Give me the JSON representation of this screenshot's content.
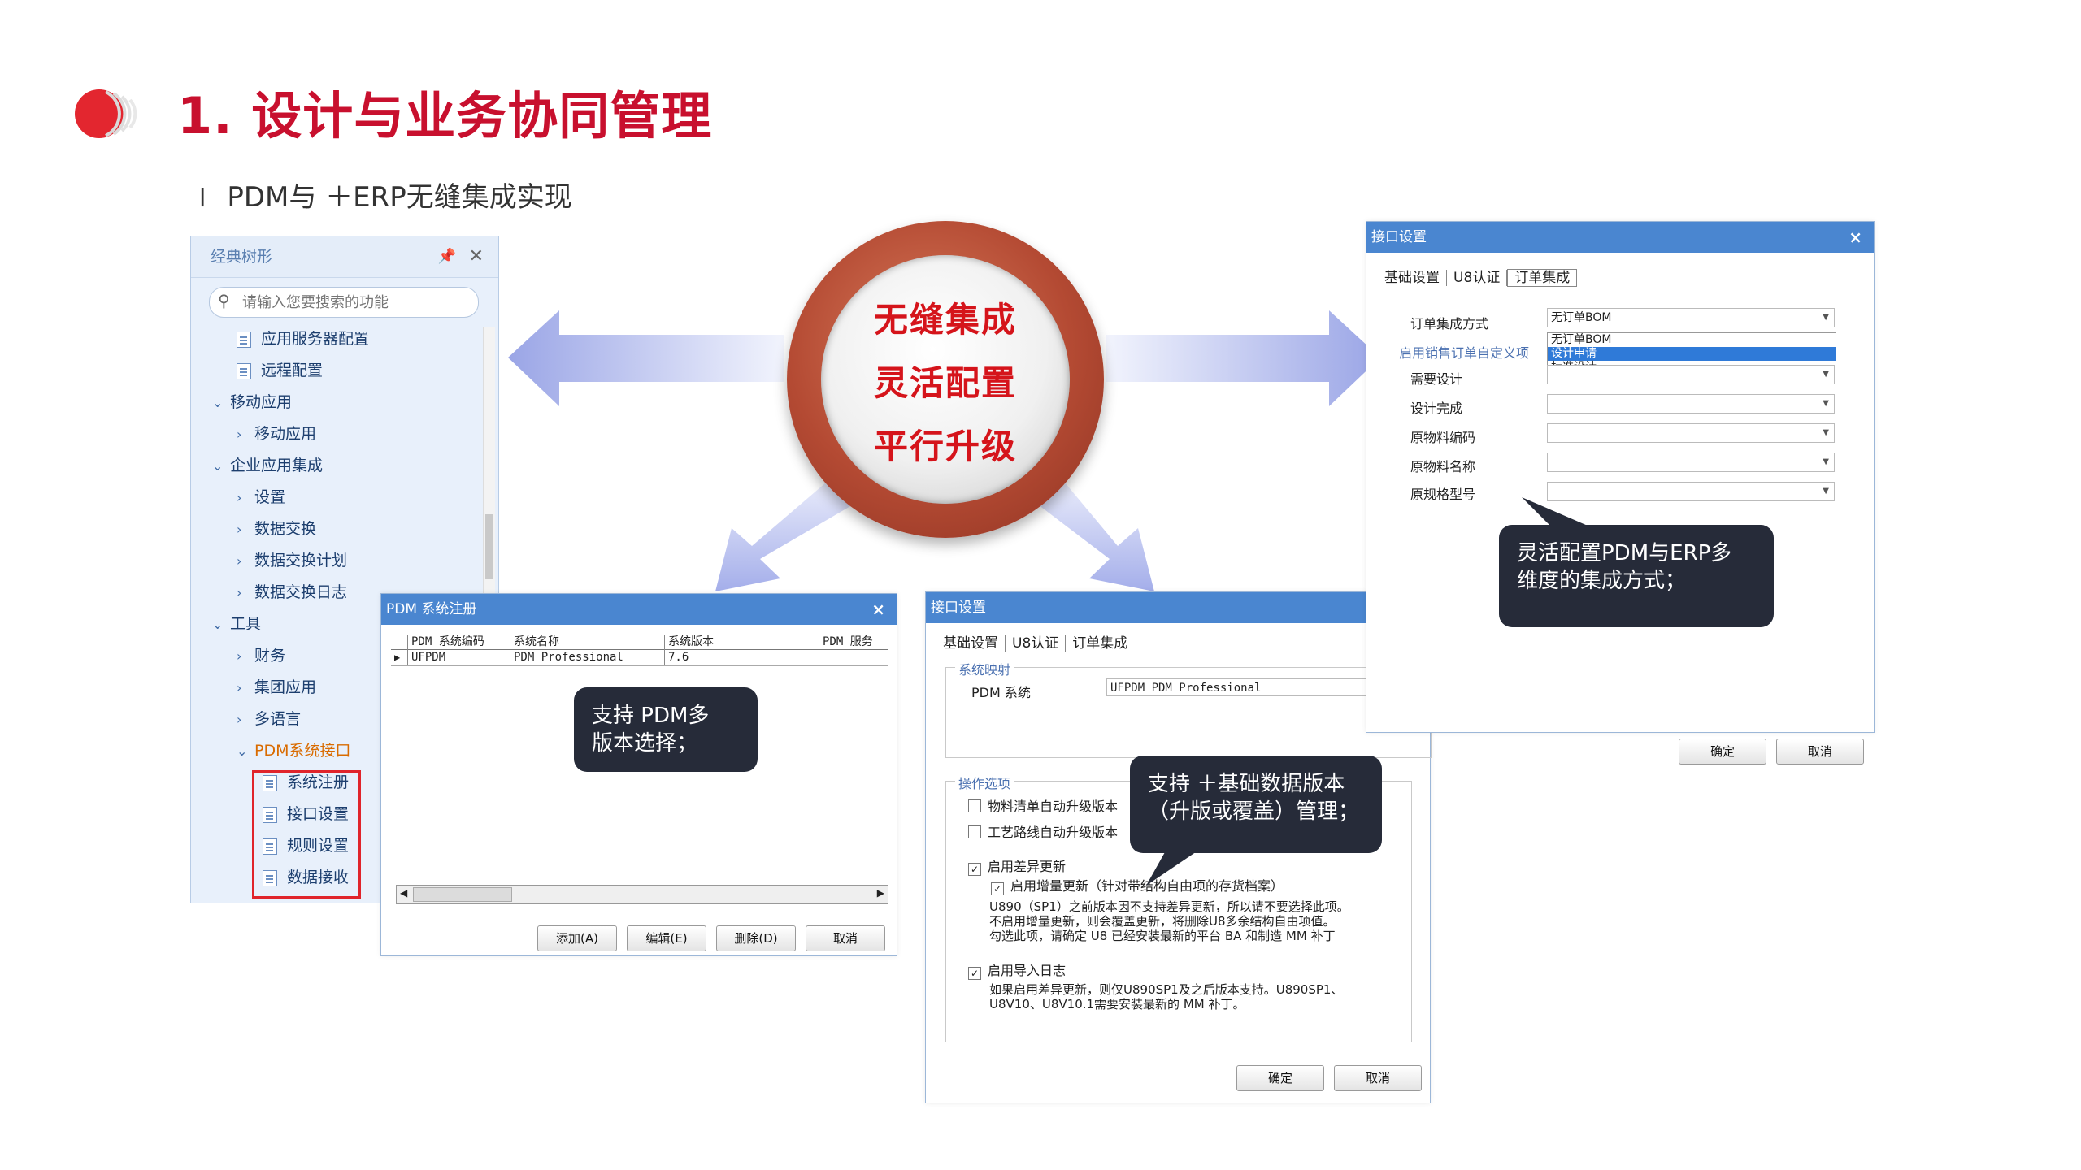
{
  "header": {
    "title": "1. 设计与业务协同管理",
    "subtitle_bullet": "l",
    "subtitle": "PDM与 ＋ERP无缝集成实现"
  },
  "badge": {
    "line1": "无缝集成",
    "line2": "灵活配置",
    "line3": "平行升级"
  },
  "tree": {
    "title": "经典树形",
    "search_placeholder": "请输入您要搜索的功能",
    "items": [
      "应用服务器配置",
      "远程配置",
      "移动应用",
      "移动应用",
      "企业应用集成",
      "设置",
      "数据交换",
      "数据交换计划",
      "数据交换日志",
      "工具",
      "财务",
      "集团应用",
      "多语言",
      "PDM系统接口",
      "系统注册",
      "接口设置",
      "规则设置",
      "数据接收"
    ]
  },
  "pdm_window": {
    "title": "PDM 系统注册",
    "columns": [
      "PDM 系统编码",
      "系统名称",
      "系统版本",
      "PDM 服务"
    ],
    "row": [
      "UFPDM",
      "PDM Professional",
      "7.6",
      ""
    ],
    "buttons": {
      "add": "添加(A)",
      "edit": "编辑(E)",
      "delete": "删除(D)",
      "cancel": "取消"
    }
  },
  "iface_bottom": {
    "title": "接口设置",
    "tabs": [
      "基础设置",
      "U8认证",
      "订单集成"
    ],
    "group_mapping": "系统映射",
    "pdm_label": "PDM 系统",
    "pdm_value": "UFPDM PDM Professional",
    "group_ops": "操作选项",
    "opt1": "物料清单自动升级版本",
    "opt2": "工艺路线自动升级版本",
    "opt3": "启用差异更新",
    "opt4": "启用增量更新（针对带结构自由项的存货档案）",
    "note1": "U890（SP1）之前版本因不支持差异更新，所以请不要选择此项。",
    "note2": "不启用增量更新，则会覆盖更新，将删除U8多余结构自由项值。",
    "note3": "勾选此项，请确定 U8 已经安装最新的平台 BA 和制造 MM 补丁",
    "opt5": "启用导入日志",
    "note4": "如果启用差异更新，则仅U890SP1及之后版本支持。U890SP1、",
    "note5": "U8V10、U8V10.1需要安装最新的 MM 补丁。",
    "ok": "确定",
    "cancel": "取消",
    "check_mark": "✓"
  },
  "iface_right": {
    "title": "接口设置",
    "tabs": [
      "基础设置",
      "U8认证",
      "订单集成"
    ],
    "mode_label": "订单集成方式",
    "mode_value": "无订单BOM",
    "dropdown": [
      "无订单BOM",
      "设计申请",
      "标准设计"
    ],
    "group": "启用销售订单自定义项",
    "fields": [
      "需要设计",
      "设计完成",
      "原物料编码",
      "原物料名称",
      "原规格型号"
    ],
    "ok": "确定",
    "cancel": "取消"
  },
  "callouts": {
    "pdm": [
      "支持  PDM多",
      "版本选择；"
    ],
    "base": [
      "支持 ＋基础数据版本",
      "（升版或覆盖）管理；"
    ],
    "flex": [
      "灵活配置PDM与ERP多",
      "维度的集成方式；"
    ]
  },
  "colors": {
    "title_red": "#c8102e",
    "window_bar": "#4a86d0",
    "callout_bg": "#262b39",
    "arrow": "#a9b3ec"
  }
}
